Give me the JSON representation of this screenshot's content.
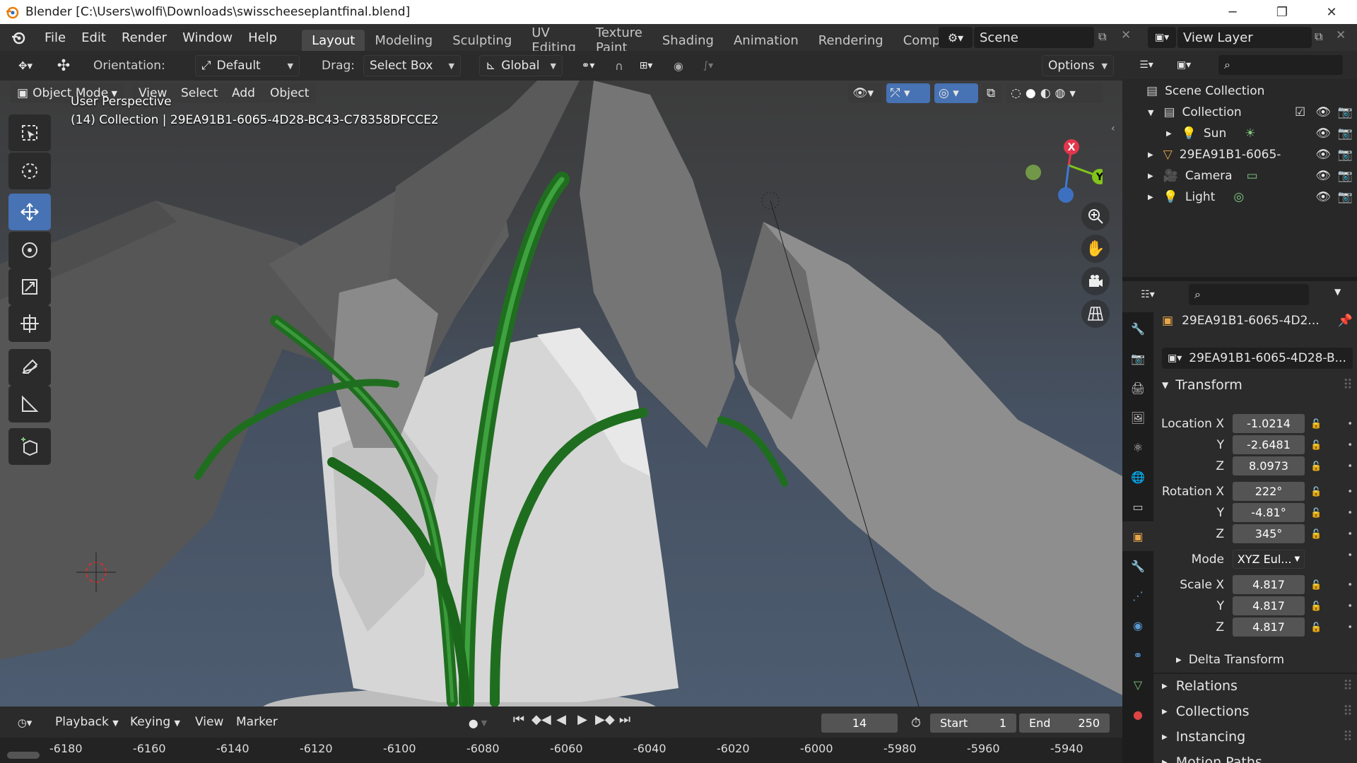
{
  "window": {
    "title": "Blender [C:\\Users\\wolfi\\Downloads\\swisscheeseplantfinal.blend]",
    "minimize": "─",
    "restore": "❐",
    "close": "✕"
  },
  "menu": [
    "File",
    "Edit",
    "Render",
    "Window",
    "Help"
  ],
  "workspaces": [
    "Layout",
    "Modeling",
    "Sculpting",
    "UV Editing",
    "Texture Paint",
    "Shading",
    "Animation",
    "Rendering",
    "Compos"
  ],
  "scene": {
    "name": "Scene"
  },
  "view_layer": {
    "name": "View Layer"
  },
  "toolheader": {
    "orientation_label": "Orientation:",
    "orientation_value": "Default",
    "drag_label": "Drag:",
    "drag_value": "Select Box",
    "transform_orientation": "Global",
    "options": "Options"
  },
  "viewport_header": {
    "mode": "Object Mode",
    "menus": [
      "View",
      "Select",
      "Add",
      "Object"
    ]
  },
  "viewport_info": {
    "line1": "User Perspective",
    "line2": "(14) Collection | 29EA91B1-6065-4D28-BC43-C78358DFCCE2"
  },
  "gizmo": {
    "x": "X",
    "y": "Y"
  },
  "tools": [
    "select-box-icon",
    "cursor-icon",
    "move-icon",
    "rotate-icon",
    "scale-icon",
    "transform-icon",
    "annotate-icon",
    "measure-icon",
    "add-cube-icon"
  ],
  "outliner": {
    "root": "Scene Collection",
    "collection": "Collection",
    "items": [
      {
        "name": "Sun",
        "icon": "light-icon",
        "extra": "sun-data-icon"
      },
      {
        "name": "29EA91B1-6065-",
        "icon": "mesh-icon",
        "extra": ""
      },
      {
        "name": "Camera",
        "icon": "camera-icon",
        "extra": "camera-data-icon"
      },
      {
        "name": "Light",
        "icon": "light-icon",
        "extra": "light-data-icon"
      }
    ]
  },
  "properties": {
    "object_name": "29EA91B1-6065-4D2...",
    "datablock": "29EA91B1-6065-4D28-B...",
    "transform_title": "Transform",
    "location": {
      "label": "Location X",
      "x": "-1.0214",
      "y": "-2.6481",
      "z": "8.0973"
    },
    "rotation": {
      "label": "Rotation X",
      "x": "222°",
      "y": "-4.81°",
      "z": "345°"
    },
    "mode": {
      "label": "Mode",
      "value": "XYZ Eul..."
    },
    "scale": {
      "label": "Scale X",
      "x": "4.817",
      "y": "4.817",
      "z": "4.817"
    },
    "axis_y": "Y",
    "axis_z": "Z",
    "delta": "Delta Transform",
    "sections": [
      "Relations",
      "Collections",
      "Instancing",
      "Motion Paths"
    ]
  },
  "timeline": {
    "playback": "Playback",
    "keying": "Keying",
    "view": "View",
    "marker": "Marker",
    "current_frame": "14",
    "start_label": "Start",
    "start": "1",
    "end_label": "End",
    "end": "250",
    "ruler": [
      "-6180",
      "-6160",
      "-6140",
      "-6120",
      "-6100",
      "-6080",
      "-6060",
      "-6040",
      "-6020",
      "-6000",
      "-5980",
      "-5960",
      "-5940"
    ]
  },
  "colors": {
    "accent": "#4772b3",
    "x_axis": "#e2364d",
    "y_axis": "#82c41a",
    "z_axis": "#3d7ad6",
    "orange": "#e87d0d"
  }
}
